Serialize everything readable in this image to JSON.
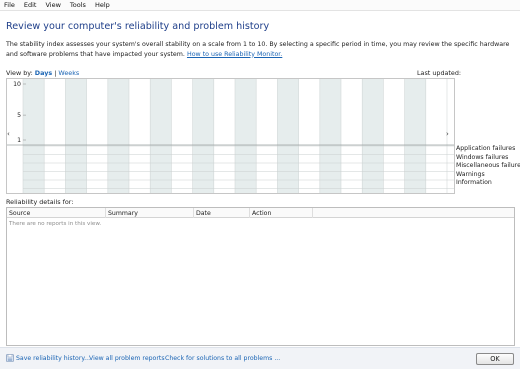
{
  "menubar": {
    "items": [
      "File",
      "Edit",
      "View",
      "Tools",
      "Help"
    ]
  },
  "page": {
    "title": "Review your computer's reliability and problem history",
    "description": "The stability index assesses your system's overall stability on a scale from 1 to 10. By selecting a specific period in time, you may review the specific hardware and software problems that have impacted your system.",
    "help_link": "How to use Reliability Monitor."
  },
  "viewby": {
    "label": "View by:",
    "days": "Days",
    "separator": "|",
    "weeks": "Weeks"
  },
  "last_updated_label": "Last updated:",
  "chart_data": {
    "type": "table",
    "y_ticks": [
      "10",
      "5",
      "1"
    ],
    "ylim": [
      1,
      10
    ],
    "columns": 20,
    "series": [],
    "rows": [
      "Application failures",
      "Windows failures",
      "Miscellaneous failures",
      "Warnings",
      "Information"
    ],
    "grid": true,
    "shaded_column_color": "#e6eded"
  },
  "nav": {
    "left_arrow": "‹",
    "right_arrow": "›"
  },
  "details": {
    "label": "Reliability details for:",
    "columns": [
      "Source",
      "Summary",
      "Date",
      "Action"
    ],
    "empty_message": "There are no reports in this view."
  },
  "footer": {
    "save_label": "Save reliability history...",
    "view_all_label": "View all problem reports",
    "check_label": "Check for solutions to all problems ...",
    "ok_label": "OK"
  },
  "colors": {
    "title": "#1f3f8a",
    "link": "#1a64b4",
    "footer_bg": "#f1f3f7"
  }
}
